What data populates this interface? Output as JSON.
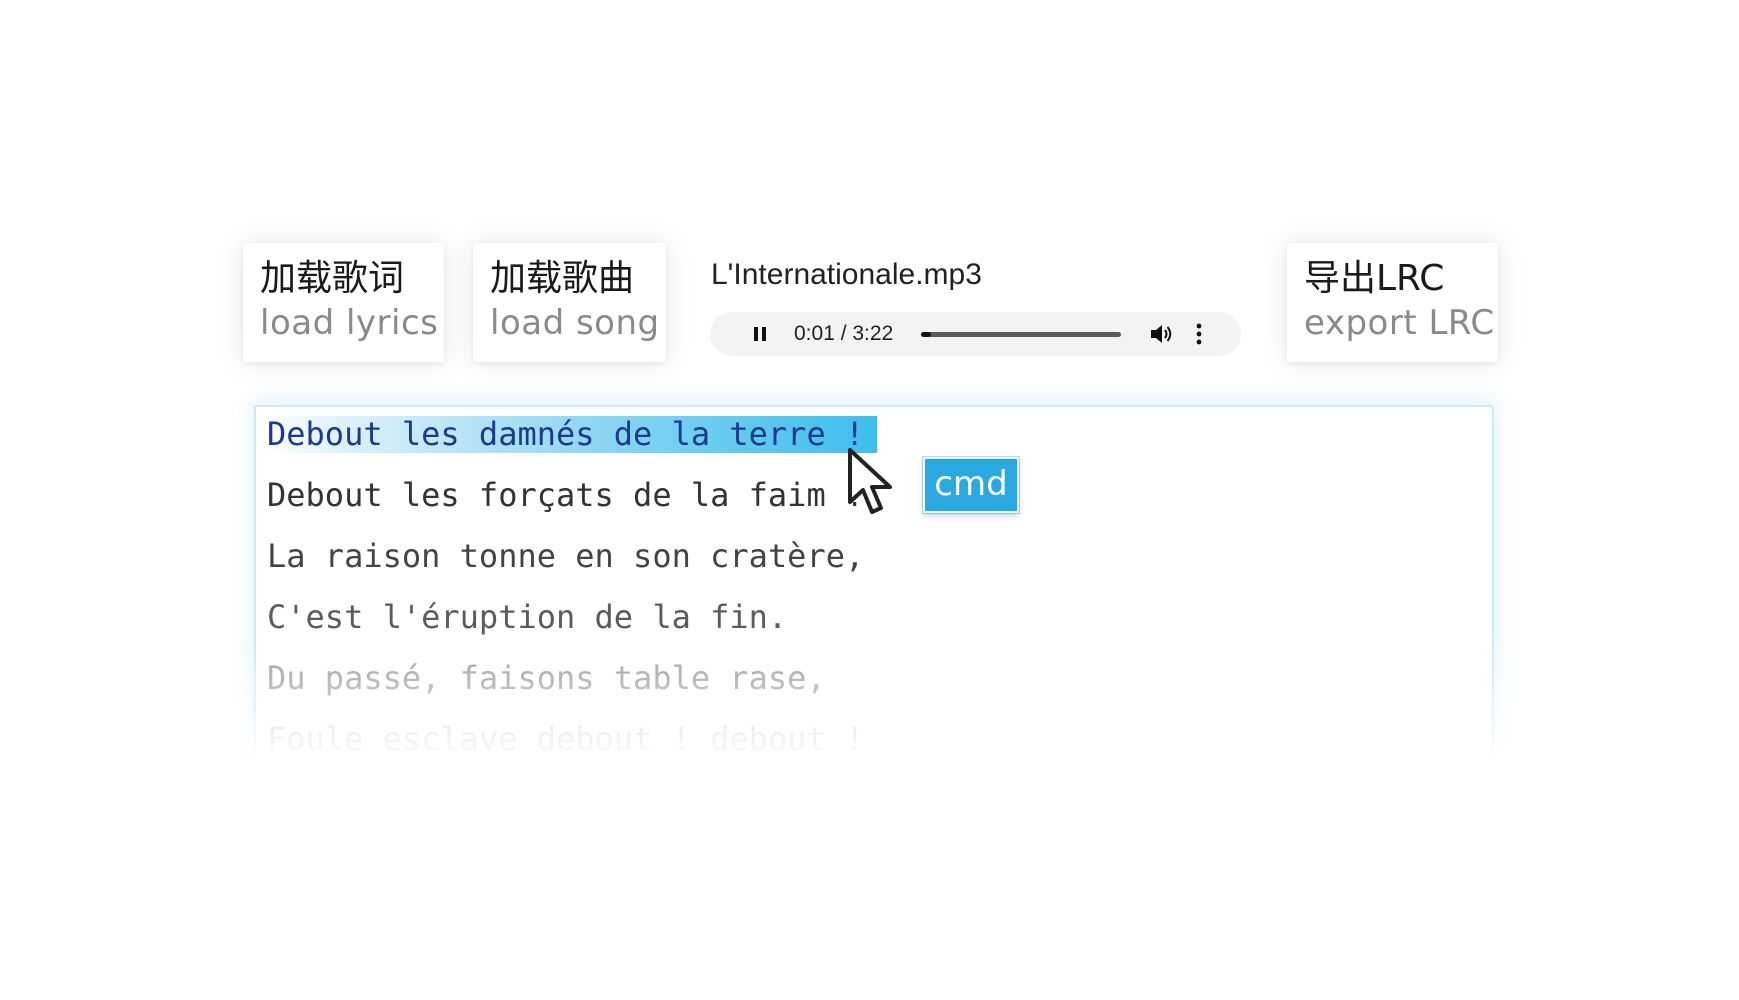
{
  "toolbar": {
    "load_lyrics": {
      "zh": "加载歌词",
      "en": "load lyrics"
    },
    "load_song": {
      "zh": "加载歌曲",
      "en": "load song"
    },
    "export_lrc": {
      "zh": "导出LRC",
      "en": "export LRC"
    }
  },
  "player": {
    "file_name": "L'Internationale.mp3",
    "time": "0:01 / 3:22",
    "progress_fraction": 0.005,
    "state": "playing",
    "icons": {
      "pause": "pause-icon",
      "volume": "volume-icon",
      "more": "more-vert-icon"
    }
  },
  "lyrics": {
    "lines": [
      {
        "text": "Debout les damnés de la terre !"
      },
      {
        "text": "Debout les forçats de la faim !"
      },
      {
        "text": "La raison tonne en son cratère,"
      },
      {
        "text": "C'est l'éruption de la fin."
      },
      {
        "text": "Du passé, faisons table rase,"
      },
      {
        "text": "Foule esclave debout ! debout !"
      }
    ]
  },
  "overlay": {
    "key_label": "cmd",
    "cursor_icon": "mouse-pointer-icon"
  },
  "colors": {
    "accent": "#2aa8e0",
    "highlight_text": "#1b3a8c",
    "player_bg": "#f1f3f4"
  }
}
